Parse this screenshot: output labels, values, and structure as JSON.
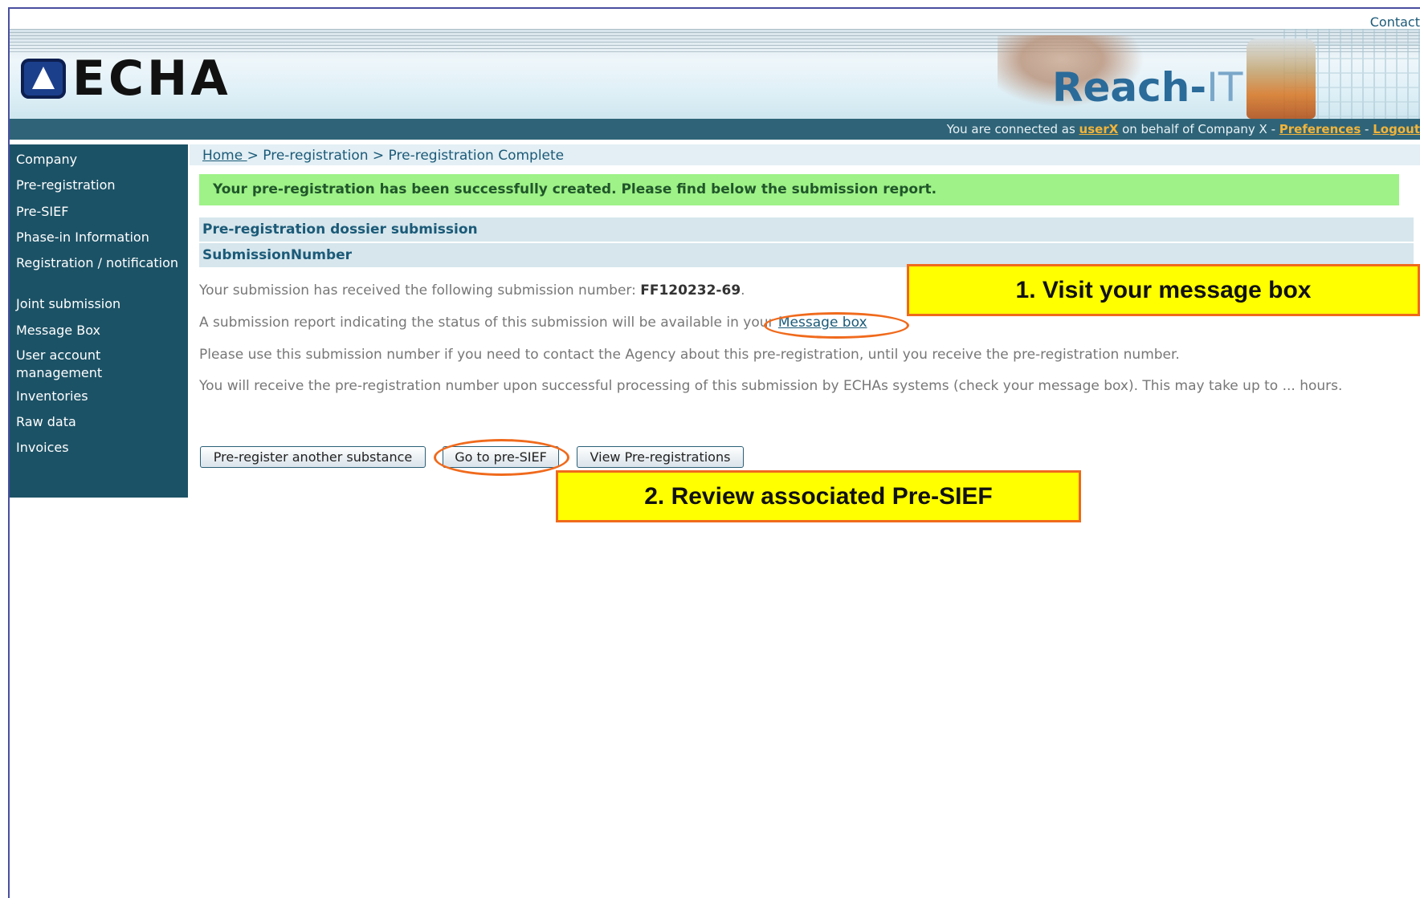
{
  "header": {
    "contact": "Contact",
    "logo_text": "ECHA",
    "app_name_reach": "Reach-",
    "app_name_it": "IT",
    "status_prefix": "You are connected as ",
    "user": "userX",
    "status_middle": " on behalf of Company X - ",
    "preferences": "Preferences",
    "separator": " - ",
    "logout": "Logout"
  },
  "sidebar": {
    "items": [
      {
        "label": "Company"
      },
      {
        "label": "Pre-registration"
      },
      {
        "label": "Pre-SIEF"
      },
      {
        "label": "Phase-in Information"
      },
      {
        "label": "Registration / notification"
      },
      {
        "label": "Joint submission"
      },
      {
        "label": "Message Box"
      },
      {
        "label": "User account management"
      },
      {
        "label": "Inventories"
      },
      {
        "label": "Raw data"
      },
      {
        "label": "Invoices"
      }
    ]
  },
  "breadcrumb": {
    "home": "Home ",
    "rest": " > Pre-registration > Pre-registration Complete"
  },
  "main": {
    "success_message": "Your pre-registration has been successfully created. Please find below the submission report.",
    "section1": "Pre-registration dossier submission",
    "section2": "SubmissionNumber",
    "p1_text": "Your submission has received the following submission number: ",
    "submission_number": "FF120232-69",
    "p1_end": ".",
    "p2_text": "A submission report indicating the status of this submission will be available in your ",
    "message_box_link": "Message box",
    "p3": "Please use this submission number if you need to contact the Agency about this pre-registration, until you receive the pre-registration number.",
    "p4": "You will receive the pre-registration number upon successful processing of this submission by ECHAs systems (check your message box). This may take up to ... hours."
  },
  "buttons": {
    "preregister_another": "Pre-register another substance",
    "go_to_presief": "Go to pre-SIEF",
    "view_preregistrations": "View Pre-registrations"
  },
  "callouts": {
    "one": "1. Visit your message box",
    "two": "2. Review associated Pre-SIEF"
  },
  "colors": {
    "accent": "#f06a1c",
    "callout_bg": "#ffff00",
    "sidebar_bg": "#1c5266",
    "success_bg": "#9ef287"
  }
}
